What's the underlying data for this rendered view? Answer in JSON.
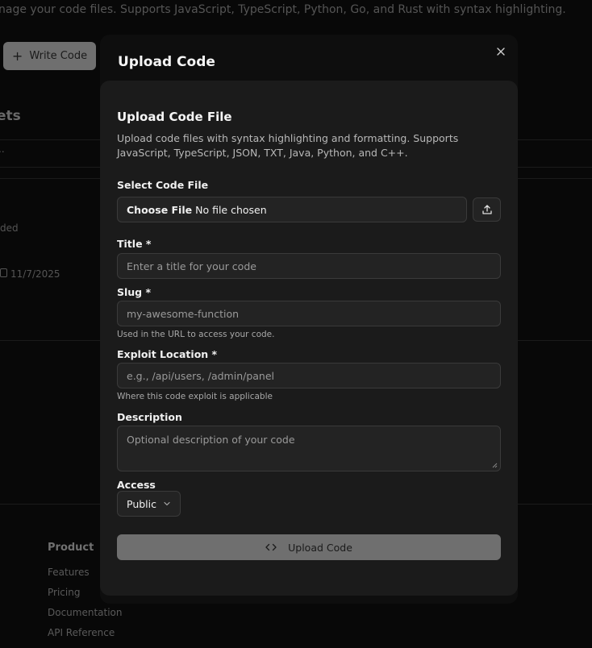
{
  "background": {
    "description": "nage your code files. Supports JavaScript, TypeScript, Python, Go, and Rust with syntax highlighting.",
    "write_button_label": "Write Code",
    "section_heading": "ets",
    "partial_text_1": "..",
    "partial_text_2": "ded",
    "date": "11/7/2025",
    "footer": {
      "heading": "Product",
      "links": [
        "Features",
        "Pricing",
        "Documentation",
        "API Reference"
      ]
    }
  },
  "modal": {
    "title": "Upload Code",
    "card_title": "Upload Code File",
    "card_description": "Upload code files with syntax highlighting and formatting. Supports JavaScript, TypeScript, JSON, TXT, Java, Python, and C++.",
    "file": {
      "label": "Select Code File",
      "button_label": "Choose File",
      "status": "No file chosen"
    },
    "title_field": {
      "label": "Title *",
      "placeholder": "Enter a title for your code"
    },
    "slug_field": {
      "label": "Slug *",
      "placeholder": "my-awesome-function",
      "help": "Used in the URL to access your code."
    },
    "exploit_field": {
      "label": "Exploit Location *",
      "placeholder": "e.g., /api/users, /admin/panel",
      "help": "Where this code exploit is applicable"
    },
    "description_field": {
      "label": "Description",
      "placeholder": "Optional description of your code"
    },
    "access": {
      "label": "Access",
      "selected": "Public"
    },
    "submit_label": "Upload Code"
  },
  "icons": {
    "plus": "plus-icon",
    "close": "close-icon",
    "upload": "upload-icon",
    "code": "code-icon",
    "chevron": "chevron-down-icon",
    "calendar": "calendar-icon"
  }
}
